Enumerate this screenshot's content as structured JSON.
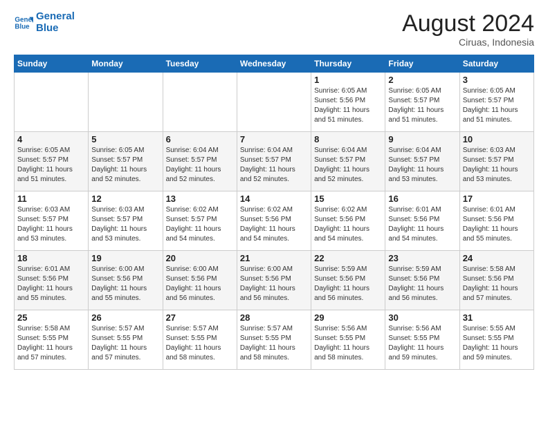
{
  "logo": {
    "line1": "General",
    "line2": "Blue"
  },
  "title": "August 2024",
  "subtitle": "Ciruas, Indonesia",
  "days_header": [
    "Sunday",
    "Monday",
    "Tuesday",
    "Wednesday",
    "Thursday",
    "Friday",
    "Saturday"
  ],
  "weeks": [
    [
      {
        "num": "",
        "info": ""
      },
      {
        "num": "",
        "info": ""
      },
      {
        "num": "",
        "info": ""
      },
      {
        "num": "",
        "info": ""
      },
      {
        "num": "1",
        "info": "Sunrise: 6:05 AM\nSunset: 5:56 PM\nDaylight: 11 hours\nand 51 minutes."
      },
      {
        "num": "2",
        "info": "Sunrise: 6:05 AM\nSunset: 5:57 PM\nDaylight: 11 hours\nand 51 minutes."
      },
      {
        "num": "3",
        "info": "Sunrise: 6:05 AM\nSunset: 5:57 PM\nDaylight: 11 hours\nand 51 minutes."
      }
    ],
    [
      {
        "num": "4",
        "info": "Sunrise: 6:05 AM\nSunset: 5:57 PM\nDaylight: 11 hours\nand 51 minutes."
      },
      {
        "num": "5",
        "info": "Sunrise: 6:05 AM\nSunset: 5:57 PM\nDaylight: 11 hours\nand 52 minutes."
      },
      {
        "num": "6",
        "info": "Sunrise: 6:04 AM\nSunset: 5:57 PM\nDaylight: 11 hours\nand 52 minutes."
      },
      {
        "num": "7",
        "info": "Sunrise: 6:04 AM\nSunset: 5:57 PM\nDaylight: 11 hours\nand 52 minutes."
      },
      {
        "num": "8",
        "info": "Sunrise: 6:04 AM\nSunset: 5:57 PM\nDaylight: 11 hours\nand 52 minutes."
      },
      {
        "num": "9",
        "info": "Sunrise: 6:04 AM\nSunset: 5:57 PM\nDaylight: 11 hours\nand 53 minutes."
      },
      {
        "num": "10",
        "info": "Sunrise: 6:03 AM\nSunset: 5:57 PM\nDaylight: 11 hours\nand 53 minutes."
      }
    ],
    [
      {
        "num": "11",
        "info": "Sunrise: 6:03 AM\nSunset: 5:57 PM\nDaylight: 11 hours\nand 53 minutes."
      },
      {
        "num": "12",
        "info": "Sunrise: 6:03 AM\nSunset: 5:57 PM\nDaylight: 11 hours\nand 53 minutes."
      },
      {
        "num": "13",
        "info": "Sunrise: 6:02 AM\nSunset: 5:57 PM\nDaylight: 11 hours\nand 54 minutes."
      },
      {
        "num": "14",
        "info": "Sunrise: 6:02 AM\nSunset: 5:56 PM\nDaylight: 11 hours\nand 54 minutes."
      },
      {
        "num": "15",
        "info": "Sunrise: 6:02 AM\nSunset: 5:56 PM\nDaylight: 11 hours\nand 54 minutes."
      },
      {
        "num": "16",
        "info": "Sunrise: 6:01 AM\nSunset: 5:56 PM\nDaylight: 11 hours\nand 54 minutes."
      },
      {
        "num": "17",
        "info": "Sunrise: 6:01 AM\nSunset: 5:56 PM\nDaylight: 11 hours\nand 55 minutes."
      }
    ],
    [
      {
        "num": "18",
        "info": "Sunrise: 6:01 AM\nSunset: 5:56 PM\nDaylight: 11 hours\nand 55 minutes."
      },
      {
        "num": "19",
        "info": "Sunrise: 6:00 AM\nSunset: 5:56 PM\nDaylight: 11 hours\nand 55 minutes."
      },
      {
        "num": "20",
        "info": "Sunrise: 6:00 AM\nSunset: 5:56 PM\nDaylight: 11 hours\nand 56 minutes."
      },
      {
        "num": "21",
        "info": "Sunrise: 6:00 AM\nSunset: 5:56 PM\nDaylight: 11 hours\nand 56 minutes."
      },
      {
        "num": "22",
        "info": "Sunrise: 5:59 AM\nSunset: 5:56 PM\nDaylight: 11 hours\nand 56 minutes."
      },
      {
        "num": "23",
        "info": "Sunrise: 5:59 AM\nSunset: 5:56 PM\nDaylight: 11 hours\nand 56 minutes."
      },
      {
        "num": "24",
        "info": "Sunrise: 5:58 AM\nSunset: 5:56 PM\nDaylight: 11 hours\nand 57 minutes."
      }
    ],
    [
      {
        "num": "25",
        "info": "Sunrise: 5:58 AM\nSunset: 5:55 PM\nDaylight: 11 hours\nand 57 minutes."
      },
      {
        "num": "26",
        "info": "Sunrise: 5:57 AM\nSunset: 5:55 PM\nDaylight: 11 hours\nand 57 minutes."
      },
      {
        "num": "27",
        "info": "Sunrise: 5:57 AM\nSunset: 5:55 PM\nDaylight: 11 hours\nand 58 minutes."
      },
      {
        "num": "28",
        "info": "Sunrise: 5:57 AM\nSunset: 5:55 PM\nDaylight: 11 hours\nand 58 minutes."
      },
      {
        "num": "29",
        "info": "Sunrise: 5:56 AM\nSunset: 5:55 PM\nDaylight: 11 hours\nand 58 minutes."
      },
      {
        "num": "30",
        "info": "Sunrise: 5:56 AM\nSunset: 5:55 PM\nDaylight: 11 hours\nand 59 minutes."
      },
      {
        "num": "31",
        "info": "Sunrise: 5:55 AM\nSunset: 5:55 PM\nDaylight: 11 hours\nand 59 minutes."
      }
    ]
  ]
}
